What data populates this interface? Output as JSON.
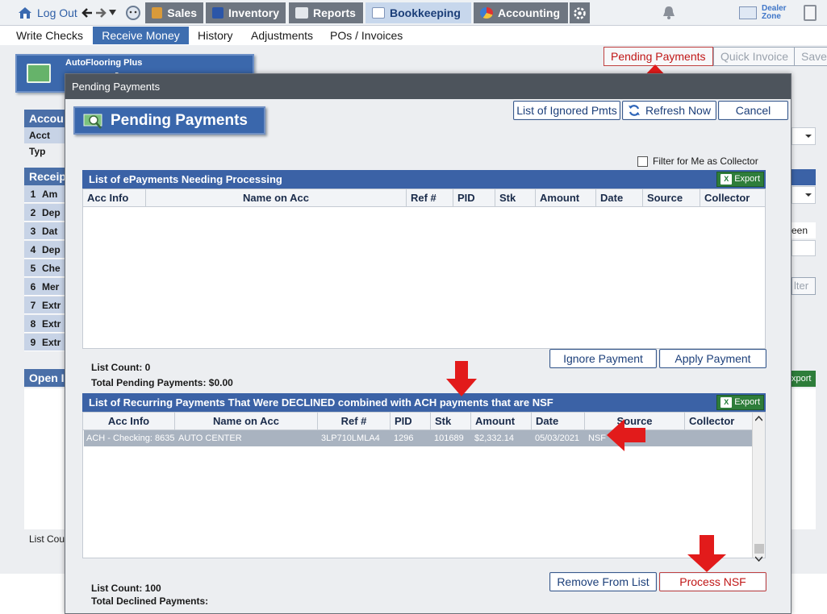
{
  "topnav": {
    "logout": "Log Out",
    "tabs": [
      {
        "label": "Sales"
      },
      {
        "label": "Inventory"
      },
      {
        "label": "Reports"
      },
      {
        "label": "Bookkeeping"
      },
      {
        "label": "Accounting"
      }
    ],
    "dealer_zone_line1": "Dealer",
    "dealer_zone_line2": "Zone"
  },
  "subnav": {
    "items": [
      "Write Checks",
      "Receive Money",
      "History",
      "Adjustments",
      "POs / Invoices"
    ],
    "active": "Receive Money"
  },
  "background": {
    "header_sub": "AutoFlooring Plus",
    "header_main": "Receive Money",
    "account_label": "Accou",
    "acct_type_label": "Acct Typ",
    "receipt_label": "Receip",
    "rows": [
      {
        "n": "1",
        "t": "Am"
      },
      {
        "n": "2",
        "t": "Dep"
      },
      {
        "n": "3",
        "t": "Dat"
      },
      {
        "n": "4",
        "t": "Dep"
      },
      {
        "n": "5",
        "t": "Che"
      },
      {
        "n": "6",
        "t": "Mer"
      },
      {
        "n": "7",
        "t": "Extr"
      },
      {
        "n": "8",
        "t": "Extr"
      },
      {
        "n": "9",
        "t": "Extr"
      }
    ],
    "open_label": "Open I",
    "list_count": "List Cou",
    "right_partial_een": "een",
    "right_partial_ilter": "lter",
    "right_partial_export": "xport",
    "buttons": {
      "pending_payments": "Pending Payments",
      "quick_invoice": "Quick Invoice",
      "save": "Save"
    }
  },
  "modal": {
    "title": "Pending Payments",
    "badge": "Pending Payments",
    "btn_ignored": "List of Ignored Pmts",
    "btn_refresh": "Refresh Now",
    "btn_cancel": "Cancel",
    "filter_label": "Filter for Me as Collector",
    "epay": {
      "title": "List of ePayments Needing Processing",
      "export": "Export",
      "columns": [
        "Acc Info",
        "Name on Acc",
        "Ref #",
        "PID",
        "Stk",
        "Amount",
        "Date",
        "Source",
        "Collector"
      ],
      "list_count": "List Count: 0",
      "total": "Total Pending Payments: $0.00",
      "btn_ignore": "Ignore Payment",
      "btn_apply": "Apply Payment"
    },
    "declined": {
      "title": "List of Recurring Payments That Were DECLINED combined with ACH payments that are NSF",
      "export": "Export",
      "columns": [
        "Acc Info",
        "Name on Acc",
        "Ref #",
        "PID",
        "Stk",
        "Amount",
        "Date",
        "Source",
        "Collector"
      ],
      "rows": [
        {
          "acc": "ACH - Checking: 8635",
          "name": "AUTO CENTER",
          "ref": "3LP710LMLA4",
          "pid": "1296",
          "stk": "101689",
          "amount": "$2,332.14",
          "date": "05/03/2021",
          "source": "NSF",
          "collector": ""
        }
      ],
      "list_count": "List Count: 100",
      "total": "Total Declined Payments:",
      "btn_remove": "Remove From List",
      "btn_process": "Process NSF"
    }
  },
  "colors": {
    "accent_blue": "#3b62a6",
    "annotation_red": "#e21b1b",
    "topnav_dark": "#6e7681"
  }
}
